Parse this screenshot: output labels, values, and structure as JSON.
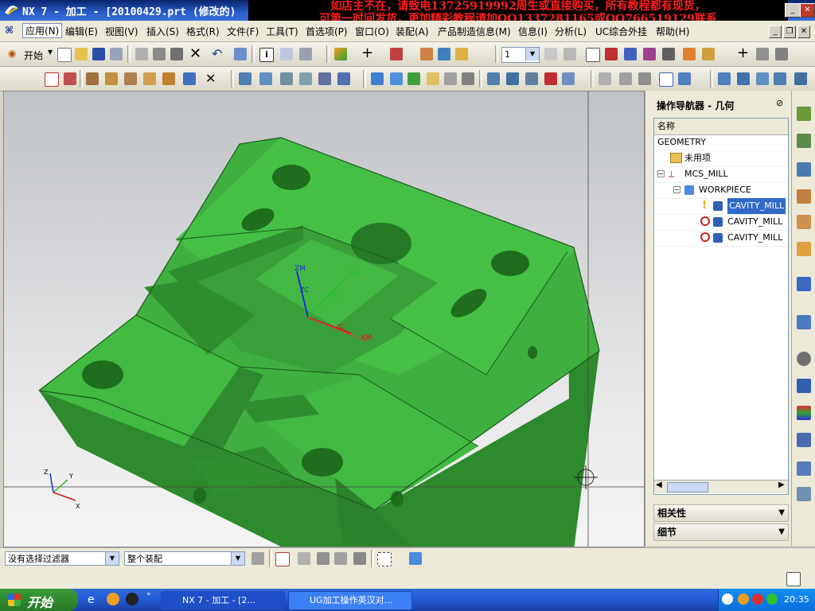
{
  "window": {
    "title": "NX 7 - 加工 - [20100429.prt  (修改的)"
  },
  "promo": {
    "line1": "如店主不在，请致电13725919992周生或直接购买，所有教程都有现货，",
    "line2": "可第一时间发货，更加精彩教程请加QQ1337281165或QQ766519129联系"
  },
  "menu": [
    "应用(N)",
    "编辑(E)",
    "视图(V)",
    "插入(S)",
    "格式(R)",
    "文件(F)",
    "工具(T)",
    "首选项(P)",
    "窗口(O)",
    "装配(A)",
    "产品制造信息(M)",
    "信息(I)",
    "分析(L)",
    "UC综合外挂",
    "帮助(H)"
  ],
  "toolbar": {
    "start_label": "开始",
    "layer_value": "1"
  },
  "viewport": {
    "triad": [
      "ZM",
      "YM",
      "XM",
      "ZC",
      "YC",
      "XC"
    ],
    "corner_axes": [
      "Z",
      "Y",
      "X"
    ],
    "model_color": "#3fb03f"
  },
  "navigator": {
    "title": "操作导航器 - 几何",
    "column": "名称",
    "rows": [
      {
        "label": "GEOMETRY",
        "indent": 0
      },
      {
        "label": "未用项",
        "indent": 1
      },
      {
        "label": "MCS_MILL",
        "indent": 1
      },
      {
        "label": "WORKPIECE",
        "indent": 2
      },
      {
        "label": "CAVITY_MILL",
        "indent": 3,
        "status": "warning",
        "selected": true
      },
      {
        "label": "CAVITY_MILL",
        "indent": 3,
        "status": "error"
      },
      {
        "label": "CAVITY_MILL",
        "indent": 3,
        "status": "error"
      }
    ],
    "panels": [
      "相关性",
      "细节"
    ]
  },
  "statusbar": {
    "filter": "没有选择过滤器",
    "scope": "整个装配"
  },
  "taskbar": {
    "start": "开始",
    "tasks": [
      "NX 7 - 加工 - [2...",
      "UG加工操作英汉对..."
    ],
    "time": "20:35"
  },
  "colors": {
    "title": "#0a246a",
    "promo_text": "#ff1e1e",
    "selection": "#3169c6",
    "model": "#3fb03f"
  }
}
